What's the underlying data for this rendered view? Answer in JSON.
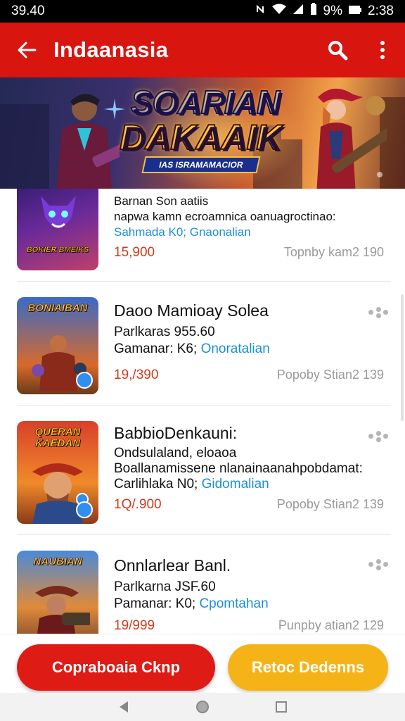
{
  "status_bar": {
    "time_left": "39.40",
    "battery": "9%",
    "time_right": "2:38"
  },
  "app_bar": {
    "title": "Indaanasia",
    "icons": [
      "back-arrow-icon",
      "search-icon",
      "more-vert-icon"
    ]
  },
  "banner": {
    "title_line1": "SOARIAN",
    "title_line2": "DAKAAIK",
    "subtitle": "IAS ISRAMAMACIOR"
  },
  "colors": {
    "app_bar": "#d8150f",
    "price": "#d33a1a",
    "link_blue": "#1a8fd8",
    "primary_button": "#df1b16",
    "secondary_button": "#f6b318"
  },
  "products": [
    {
      "thumb_label": "BOKIER BMEIKS",
      "name": "Barnan Son aatiis",
      "detail": "napwa kamn ecroamnica oanuagroctinao:",
      "meta_prefix": "Sahmada K0; ",
      "meta_link": "Gnaonalian",
      "price": "15,900",
      "sold": "Topnby kam2 190",
      "has_more": false
    },
    {
      "thumb_label": "BONIAIBAN",
      "name": "Daoo Mamioay Solea",
      "detail": "Parlkaras 955.60",
      "meta_prefix": "Gamanar: K6; ",
      "meta_link": "Onoratalian",
      "price": "19,/390",
      "sold": "Popoby Stian2 139",
      "has_more": true
    },
    {
      "thumb_label": "QUERAN KAEDAN",
      "name": "BabbioDenkauni:",
      "detail": "Ondsulaland, eloaoa",
      "detail2": "Boallanamissene nlanainaanahpobdamat:",
      "meta_prefix": "Carlihlaka N0; ",
      "meta_link": "Gidomalian",
      "price": "1Q/.900",
      "sold": "Popoby Stian2 139",
      "has_more": true
    },
    {
      "thumb_label": "NAUBIAN",
      "name": "Onnlarlear Banl.",
      "detail": "Parlkarna JSF.60",
      "meta_prefix": "Pamanar: K0; ",
      "meta_link": "Cpomtahan",
      "price": "19/999",
      "sold": "Punpby atian2 129",
      "has_more": true
    }
  ],
  "buttons": {
    "primary_label": "Copraboaia Cknp",
    "secondary_label": "Retoc Dedenns"
  },
  "nav": {
    "icons": [
      "back-triangle-icon",
      "home-circle-icon",
      "recents-square-icon"
    ]
  }
}
